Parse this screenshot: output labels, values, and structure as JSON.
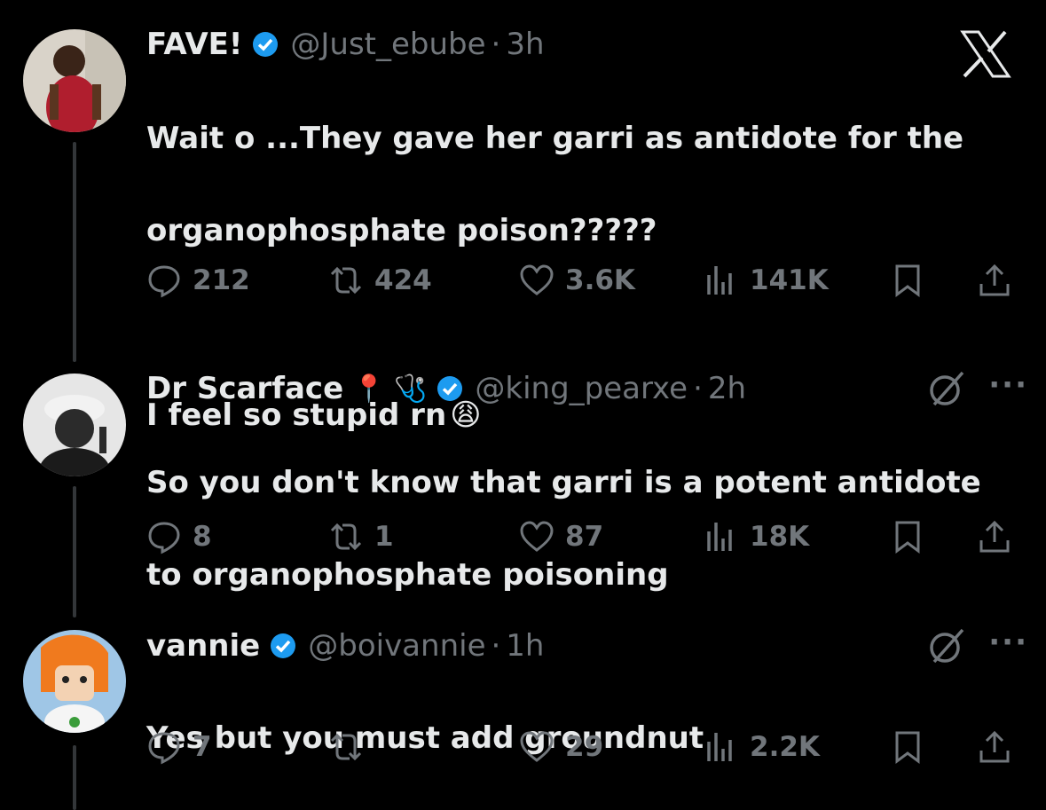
{
  "colors": {
    "background": "#000000",
    "text": "#e7e9ea",
    "muted": "#71767b",
    "verified": "#1d9bf0"
  },
  "tweets": [
    {
      "name": "FAVE!",
      "handle": "@Just_ebube",
      "dot": "·",
      "time": "3h",
      "text_lines": [
        "Wait o  ...They gave her garri as antidote for the",
        "organophosphate poison?????"
      ],
      "text_line3": "I feel so stupid rn",
      "emoji": "😩",
      "replies": "212",
      "retweets": "424",
      "likes": "3.6K",
      "views": "141K"
    },
    {
      "name": "Dr Scarface",
      "name_emojis": "📍 🩺",
      "handle": "@king_pearxe",
      "dot": "·",
      "time": "2h",
      "text_lines": [
        "So you don't know that garri is a potent antidote",
        "to organophosphate poisoning"
      ],
      "replies": "8",
      "retweets": "1",
      "likes": "87",
      "views": "18K"
    },
    {
      "name": "vannie",
      "handle": "@boivannie",
      "dot": "·",
      "time": "1h",
      "text_lines": [
        "Yes but you must add groundnut"
      ],
      "replies": "7",
      "retweets": "",
      "likes": "29",
      "views": "2.2K"
    }
  ],
  "icons": {
    "close": "x-logo-icon",
    "more": "···"
  }
}
